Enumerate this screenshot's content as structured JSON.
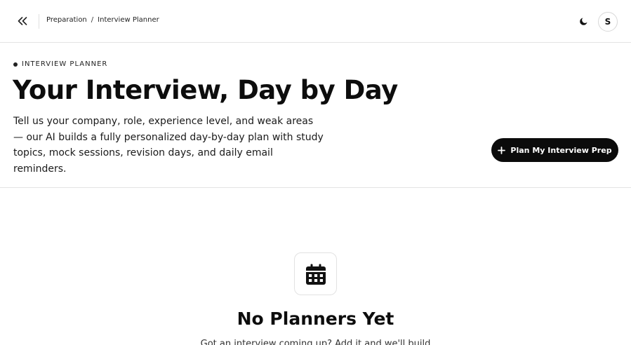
{
  "breadcrumb": {
    "parent": "Preparation",
    "separator": "/",
    "current": "Interview Planner"
  },
  "user": {
    "avatar_initial": "S"
  },
  "icons": {
    "collapse": "double-chevron-left-icon",
    "theme": "moon-icon",
    "cta": "plus-icon",
    "empty": "calendar-icon"
  },
  "hero": {
    "eyebrow": "INTERVIEW PLANNER",
    "title": "Your Interview, Day by Day",
    "description": "Tell us your company, role, experience level, and weak areas — our AI builds a fully personalized day-by-day plan with study topics, mock sessions, revision days, and daily email reminders.",
    "cta_label": "Plan My Interview Prep"
  },
  "empty_state": {
    "title": "No Planners Yet",
    "description": "Got an interview coming up? Add it and we'll build"
  },
  "colors": {
    "primary": "#0b0b0b",
    "border": "#e4e4e4",
    "background": "#ffffff"
  }
}
